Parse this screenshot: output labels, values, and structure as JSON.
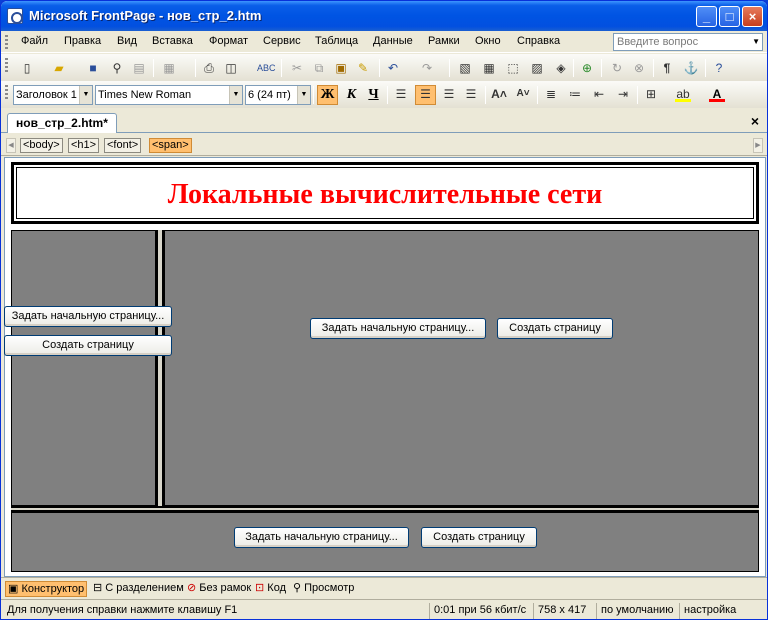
{
  "window": {
    "title": "Microsoft FrontPage - нов_стр_2.htm"
  },
  "menu": {
    "items": [
      "Файл",
      "Правка",
      "Вид",
      "Вставка",
      "Формат",
      "Сервис",
      "Таблица",
      "Данные",
      "Рамки",
      "Окно",
      "Справка"
    ],
    "help_placeholder": "Введите вопрос"
  },
  "format": {
    "style": "Заголовок 1",
    "font": "Times New Roman",
    "size": "6  (24 пт)",
    "bold": "Ж",
    "italic": "К",
    "underline": "Ч"
  },
  "tab": {
    "label": "нов_стр_2.htm*",
    "close": "×"
  },
  "tags": [
    "<body>",
    "<h1>",
    "<font>",
    "<span>"
  ],
  "page": {
    "heading": "Локальные вычислительные сети"
  },
  "frames": {
    "set_start": "Задать начальную страницу...",
    "create": "Создать страницу"
  },
  "modes": [
    "Конструктор",
    "С разделением",
    "Без рамок",
    "Код",
    "Просмотр"
  ],
  "status": {
    "help": "Для получения справки нажмите клавишу F1",
    "speed": "0:01 при 56 кбит/с",
    "size": "758 x 417",
    "default": "по умолчанию",
    "settings": "настройка"
  },
  "colors": {
    "heading": "#ff0000",
    "frame_bg": "#808080",
    "title_bar": "#0054e3",
    "highlight": "#ffbf6f"
  }
}
